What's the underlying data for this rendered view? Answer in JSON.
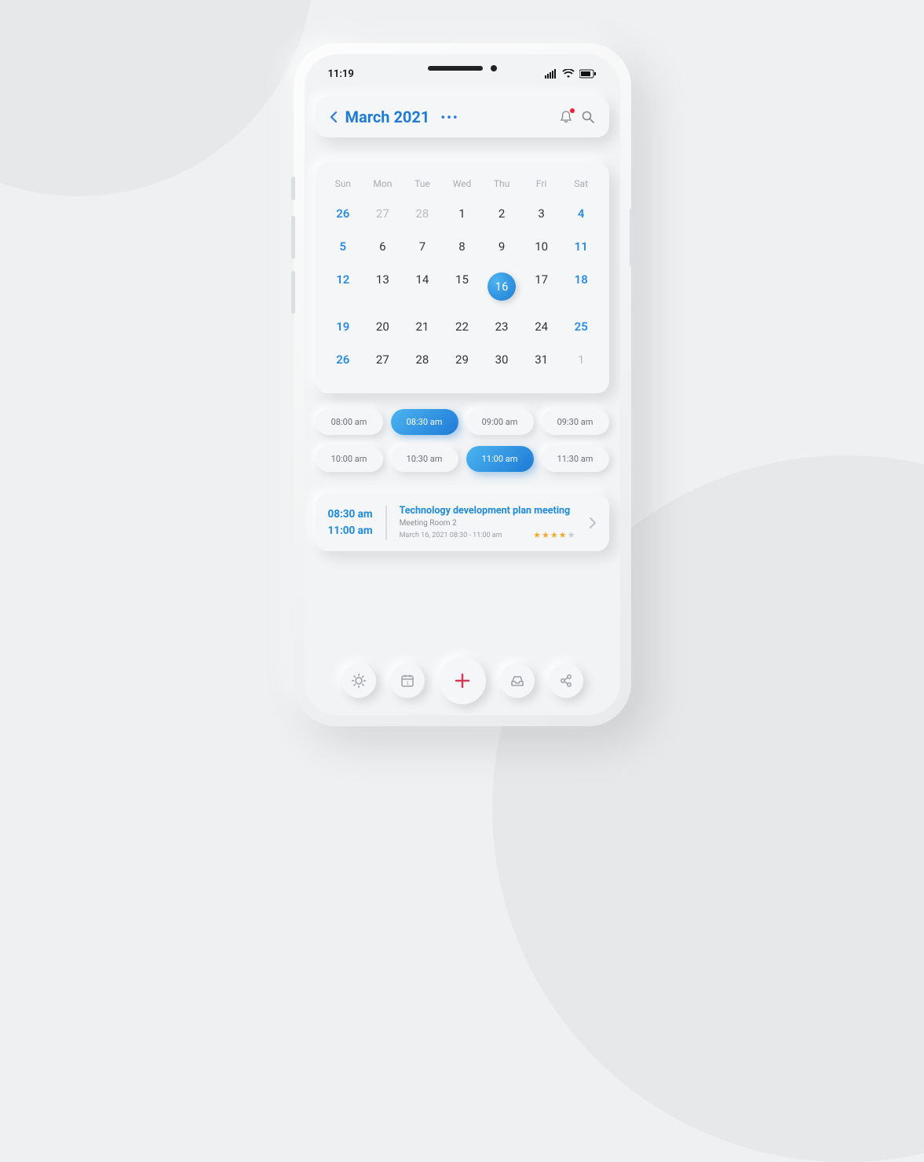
{
  "status": {
    "time": "11:19"
  },
  "header": {
    "month": "March 2021"
  },
  "calendar": {
    "dow": [
      "Sun",
      "Mon",
      "Tue",
      "Wed",
      "Thu",
      "Fri",
      "Sat"
    ],
    "weeks": [
      [
        {
          "n": "26",
          "cls": "highlight muted"
        },
        {
          "n": "27",
          "cls": "muted"
        },
        {
          "n": "28",
          "cls": "muted"
        },
        {
          "n": "1",
          "cls": ""
        },
        {
          "n": "2",
          "cls": ""
        },
        {
          "n": "3",
          "cls": ""
        },
        {
          "n": "4",
          "cls": "highlight"
        }
      ],
      [
        {
          "n": "5",
          "cls": "highlight"
        },
        {
          "n": "6",
          "cls": ""
        },
        {
          "n": "7",
          "cls": ""
        },
        {
          "n": "8",
          "cls": ""
        },
        {
          "n": "9",
          "cls": ""
        },
        {
          "n": "10",
          "cls": ""
        },
        {
          "n": "11",
          "cls": "highlight"
        }
      ],
      [
        {
          "n": "12",
          "cls": "highlight"
        },
        {
          "n": "13",
          "cls": ""
        },
        {
          "n": "14",
          "cls": ""
        },
        {
          "n": "15",
          "cls": ""
        },
        {
          "n": "16",
          "cls": "selected"
        },
        {
          "n": "17",
          "cls": ""
        },
        {
          "n": "18",
          "cls": "highlight"
        }
      ],
      [
        {
          "n": "19",
          "cls": "highlight"
        },
        {
          "n": "20",
          "cls": ""
        },
        {
          "n": "21",
          "cls": ""
        },
        {
          "n": "22",
          "cls": ""
        },
        {
          "n": "23",
          "cls": ""
        },
        {
          "n": "24",
          "cls": ""
        },
        {
          "n": "25",
          "cls": "highlight"
        }
      ],
      [
        {
          "n": "26",
          "cls": "highlight"
        },
        {
          "n": "27",
          "cls": ""
        },
        {
          "n": "28",
          "cls": ""
        },
        {
          "n": "29",
          "cls": ""
        },
        {
          "n": "30",
          "cls": ""
        },
        {
          "n": "31",
          "cls": ""
        },
        {
          "n": "1",
          "cls": "muted"
        }
      ]
    ]
  },
  "times": [
    {
      "t": "08:00 am",
      "sel": false
    },
    {
      "t": "08:30 am",
      "sel": true
    },
    {
      "t": "09:00 am",
      "sel": false
    },
    {
      "t": "09:30 am",
      "sel": false
    },
    {
      "t": "10:00 am",
      "sel": false
    },
    {
      "t": "10:30 am",
      "sel": false
    },
    {
      "t": "11:00 am",
      "sel": true
    },
    {
      "t": "11:30 am",
      "sel": false
    }
  ],
  "event": {
    "start": "08:30 am",
    "end": "11:00 am",
    "title": "Technology development plan meeting",
    "room": "Meeting Room 2",
    "detail": "March 16, 2021 08:30 - 11:00 am",
    "stars_on": 3,
    "stars_half": 1,
    "stars_off": 1
  }
}
